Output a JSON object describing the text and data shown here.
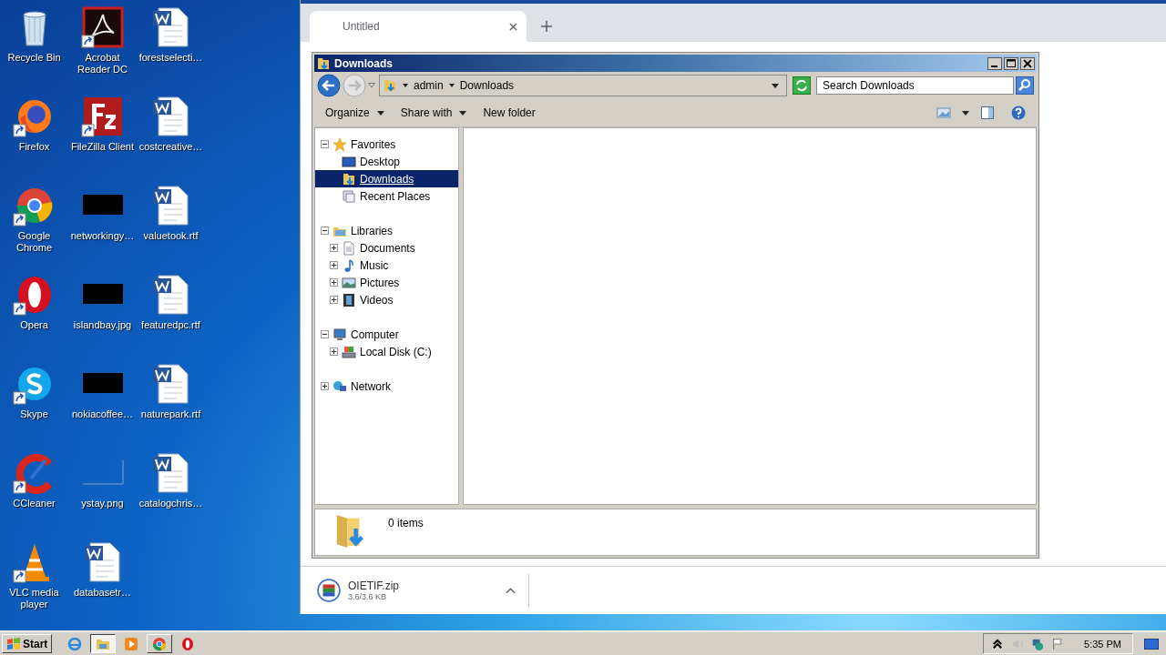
{
  "desktop_icons": [
    {
      "label": "Recycle Bin",
      "kind": "recycle",
      "shortcut": false
    },
    {
      "label": "Firefox",
      "kind": "firefox",
      "shortcut": true
    },
    {
      "label": "Google Chrome",
      "kind": "chrome",
      "shortcut": true
    },
    {
      "label": "Opera",
      "kind": "opera",
      "shortcut": true
    },
    {
      "label": "Skype",
      "kind": "skype",
      "shortcut": true
    },
    {
      "label": "CCleaner",
      "kind": "ccleaner",
      "shortcut": true
    },
    {
      "label": "VLC media player",
      "kind": "vlc",
      "shortcut": true
    },
    {
      "label": "Acrobat Reader DC",
      "kind": "pdf",
      "shortcut": true
    },
    {
      "label": "FileZilla Client",
      "kind": "filezilla",
      "shortcut": true
    },
    {
      "label": "networkingy…",
      "kind": "thumb-dark",
      "shortcut": false
    },
    {
      "label": "islandbay.jpg",
      "kind": "thumb-dark",
      "shortcut": false
    },
    {
      "label": "nokiacoffee…",
      "kind": "thumb-dark",
      "shortcut": false
    },
    {
      "label": "ystay.png",
      "kind": "thumb-blank",
      "shortcut": false
    },
    {
      "label": "databasetr…",
      "kind": "word",
      "shortcut": false
    },
    {
      "label": "forestselecti…",
      "kind": "word",
      "shortcut": false
    },
    {
      "label": "costcreative…",
      "kind": "word",
      "shortcut": false
    },
    {
      "label": "valuetook.rtf",
      "kind": "word",
      "shortcut": false
    },
    {
      "label": "featuredpc.rtf",
      "kind": "word",
      "shortcut": false
    },
    {
      "label": "naturepark.rtf",
      "kind": "word",
      "shortcut": false
    },
    {
      "label": "catalogchris…",
      "kind": "word",
      "shortcut": false
    }
  ],
  "browser": {
    "tabs": [
      {
        "title": "Untitled",
        "selected": true
      }
    ],
    "download": {
      "filename": "OIETIF.zip",
      "size": "3.6/3.6 KB"
    }
  },
  "explorer": {
    "title": "Downloads",
    "address": [
      "admin",
      "Downloads"
    ],
    "search": {
      "placeholder": "Search Downloads"
    },
    "commands": [
      {
        "label": "Organize",
        "dropdown": true
      },
      {
        "label": "Share with",
        "dropdown": true
      },
      {
        "label": "New folder",
        "dropdown": false
      }
    ],
    "tree": [
      {
        "label": "Favorites",
        "kind": "star",
        "expanded": true,
        "selected": false,
        "children": [
          {
            "label": "Desktop",
            "kind": "desktop",
            "expandable": false,
            "selected": false
          },
          {
            "label": "Downloads",
            "kind": "downloads",
            "expandable": false,
            "selected": true
          },
          {
            "label": "Recent Places",
            "kind": "recent",
            "expandable": false,
            "selected": false
          }
        ]
      },
      {
        "label": "Libraries",
        "kind": "libraries",
        "expanded": true,
        "selected": false,
        "children": [
          {
            "label": "Documents",
            "kind": "documents",
            "expandable": true,
            "selected": false
          },
          {
            "label": "Music",
            "kind": "music",
            "expandable": true,
            "selected": false
          },
          {
            "label": "Pictures",
            "kind": "pictures",
            "expandable": true,
            "selected": false
          },
          {
            "label": "Videos",
            "kind": "videos",
            "expandable": true,
            "selected": false
          }
        ]
      },
      {
        "label": "Computer",
        "kind": "computer",
        "expanded": true,
        "selected": false,
        "children": [
          {
            "label": "Local Disk (C:)",
            "kind": "disk",
            "expandable": true,
            "selected": false
          }
        ]
      },
      {
        "label": "Network",
        "kind": "network",
        "expanded": false,
        "selected": false
      }
    ],
    "status": "0 items"
  },
  "taskbar": {
    "start": "Start",
    "apps": [
      {
        "kind": "ie",
        "open": false,
        "selected": false
      },
      {
        "kind": "explorer",
        "open": true,
        "selected": true
      },
      {
        "kind": "media",
        "open": false,
        "selected": false
      },
      {
        "kind": "chrome",
        "open": true,
        "selected": false
      },
      {
        "kind": "opera",
        "open": false,
        "selected": false
      }
    ],
    "time": "5:35 PM"
  }
}
